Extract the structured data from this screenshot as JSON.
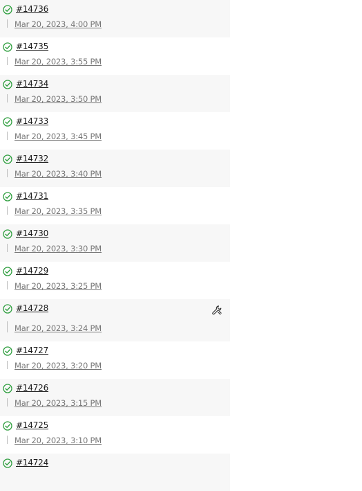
{
  "colors": {
    "success": "#2e9e3e",
    "link": "#1a1a1a",
    "timestamp": "#777777",
    "stripe": "#f7f7f7"
  },
  "builds": [
    {
      "number": "#14736",
      "time": "Mar 20, 2023, 4:00 PM",
      "status": "success"
    },
    {
      "number": "#14735",
      "time": "Mar 20, 2023, 3:55 PM",
      "status": "success"
    },
    {
      "number": "#14734",
      "time": "Mar 20, 2023, 3:50 PM",
      "status": "success"
    },
    {
      "number": "#14733",
      "time": "Mar 20, 2023, 3:45 PM",
      "status": "success"
    },
    {
      "number": "#14732",
      "time": "Mar 20, 2023, 3:40 PM",
      "status": "success"
    },
    {
      "number": "#14731",
      "time": "Mar 20, 2023, 3:35 PM",
      "status": "success"
    },
    {
      "number": "#14730",
      "time": "Mar 20, 2023, 3:30 PM",
      "status": "success"
    },
    {
      "number": "#14729",
      "time": "Mar 20, 2023, 3:25 PM",
      "status": "success"
    },
    {
      "number": "#14728",
      "time": "Mar 20, 2023, 3:24 PM",
      "status": "success",
      "icon": "wrench-icon"
    },
    {
      "number": "#14727",
      "time": "Mar 20, 2023, 3:20 PM",
      "status": "success"
    },
    {
      "number": "#14726",
      "time": "Mar 20, 2023, 3:15 PM",
      "status": "success"
    },
    {
      "number": "#14725",
      "time": "Mar 20, 2023, 3:10 PM",
      "status": "success"
    },
    {
      "number": "#14724",
      "time": "",
      "status": "success"
    }
  ]
}
